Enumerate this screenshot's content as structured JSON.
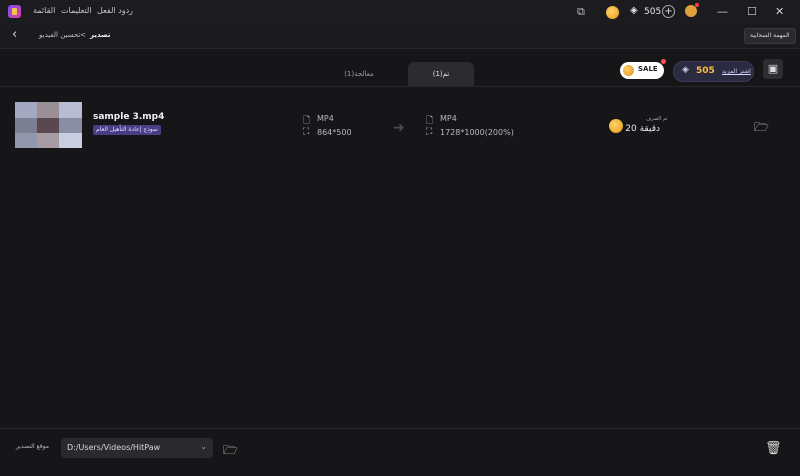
{
  "titlebar": {
    "menu": [
      "القائمة",
      "التعليمات",
      "ردود الفعل"
    ],
    "coins": "505"
  },
  "breadcrumb": {
    "parent": "تحسين الفيديو",
    "current": "تصدير",
    "separator": "<"
  },
  "header": {
    "cloud_task": "المهمة السحابية"
  },
  "tabs": [
    {
      "label": "تم(1)",
      "active": true
    },
    {
      "label": "معالجة(1)",
      "active": false
    }
  ],
  "promo": {
    "sale": "SALE",
    "buy_count": "505",
    "buy_label": "اشتر المزيد"
  },
  "file": {
    "name": "sample 3.mp4",
    "model": "نموذج إعادة التأهيل العام",
    "src_format": "MP4",
    "src_res": "864*500",
    "out_format": "MP4",
    "out_res": "1728*1000(200%)",
    "cost_label": "تم الصرف",
    "cost_value": "20 دقيقة"
  },
  "footer": {
    "save_label": "موقع التصدير",
    "path": "D:/Users/Videos/HitPaw"
  },
  "colors": {
    "background": "#161619",
    "accent": "#4a3d86",
    "coin": "#f0b030"
  }
}
